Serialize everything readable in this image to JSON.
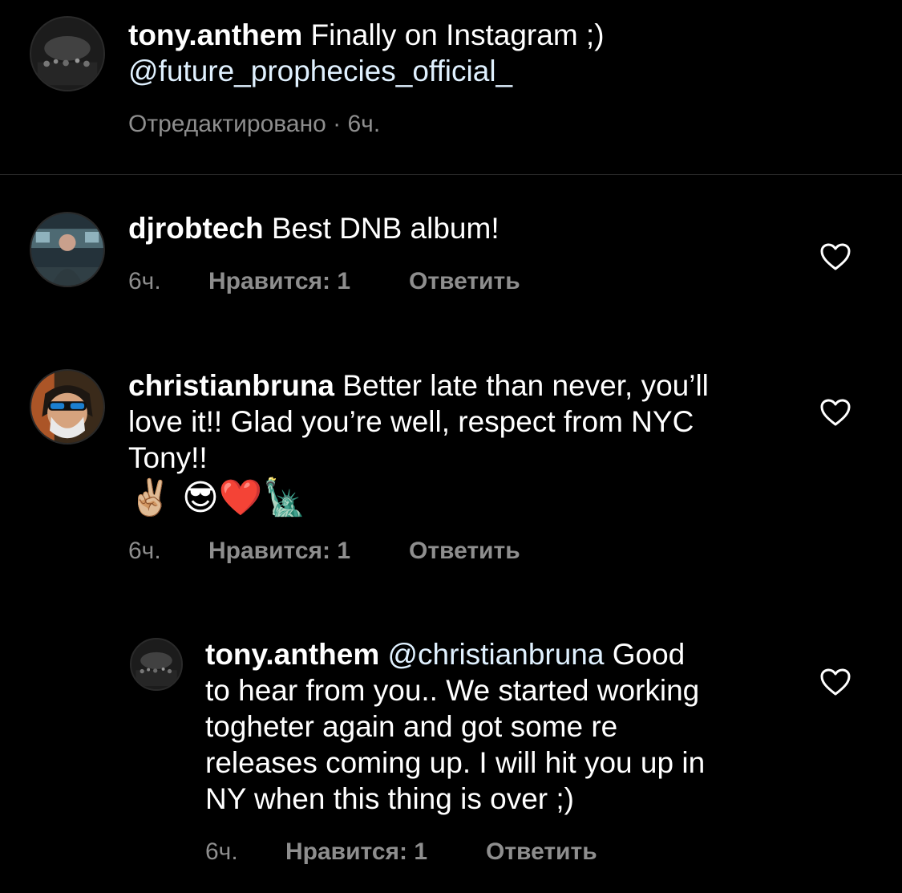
{
  "caption": {
    "username": "tony.anthem",
    "text": " Finally on Instagram ;)",
    "mention": "@future_prophecies_official_",
    "meta": "Отредактировано · 6ч."
  },
  "comments": [
    {
      "username": "djrobtech",
      "text": " Best DNB album!",
      "time": "6ч.",
      "likes": "Нравится: 1",
      "reply": "Ответить"
    },
    {
      "username": "christianbruna",
      "text_line1": " Better late than never, you’ll",
      "text_line2": "love it!! Glad you’re well, respect from NYC",
      "text_line3": "Tony!!",
      "emojis": "✌🏼 😎❤️🗽",
      "time": "6ч.",
      "likes": "Нравится: 1",
      "reply": "Ответить"
    }
  ],
  "reply": {
    "username": "tony.anthem",
    "mention": " @christianbruna",
    "text_line1": "  Good",
    "text_line2": "to hear from you.. We started working",
    "text_line3": "togheter again and got some re",
    "text_line4": "releases coming up. I will hit you up in",
    "text_line5": "NY when this thing is over ;)",
    "time": "6ч.",
    "likes": "Нравится: 1",
    "reply": "Ответить"
  },
  "icons": [
    "avatar-concert",
    "avatar-studio",
    "avatar-sunglasses",
    "heart-outline-icon"
  ]
}
